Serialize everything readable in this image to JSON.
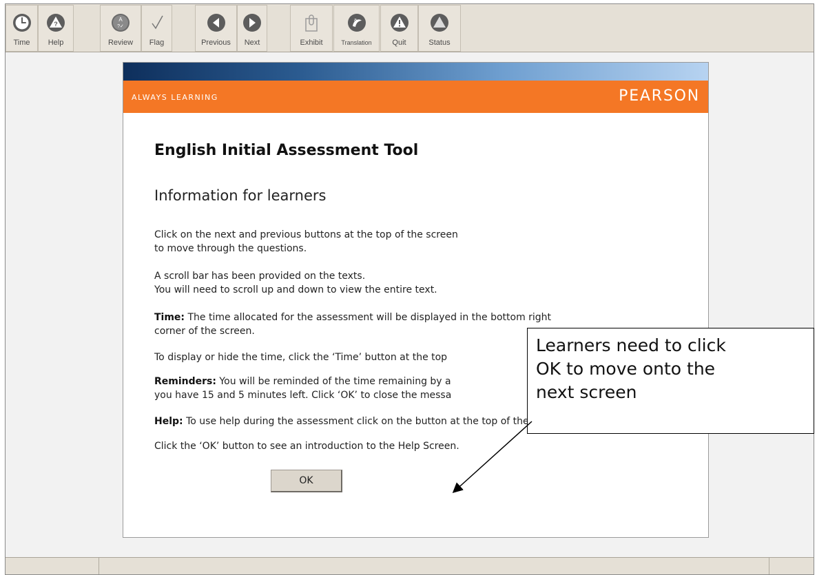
{
  "toolbar": {
    "buttons": [
      {
        "label": "Time",
        "icon": "clock-icon"
      },
      {
        "label": "Help",
        "icon": "help-icon"
      },
      {
        "label": "Review",
        "icon": "review-icon"
      },
      {
        "label": "Flag",
        "icon": "flag-checkmark-icon"
      },
      {
        "label": "Previous",
        "icon": "previous-icon"
      },
      {
        "label": "Next",
        "icon": "next-icon"
      },
      {
        "label": "Exhibit",
        "icon": "exhibit-icon"
      },
      {
        "label": "Translation",
        "icon": "translation-icon"
      },
      {
        "label": "Quit",
        "icon": "quit-icon"
      },
      {
        "label": "Status",
        "icon": "status-icon"
      }
    ]
  },
  "banner": {
    "tagline": "ALWAYS LEARNING",
    "brand": "PEARSON",
    "accent_color": "#f47725"
  },
  "dialog": {
    "title": "English Initial Assessment Tool",
    "subtitle": "Information for learners",
    "p1_line1": "Click on the next and previous buttons at the top of the screen",
    "p1_line2": "to move through the questions.",
    "p2_line1": "A scroll bar has been provided on the texts.",
    "p2_line2": "You will need to scroll up and down to view the entire text.",
    "p3_label": "Time:",
    "p3_line1": " The time allocated for the assessment will be displayed in the bottom right",
    "p3_line2": "corner of the screen.",
    "p4_line1": "To display or hide the time, click the ‘Time’ button at the top",
    "p5_label": "Reminders:",
    "p5_line1": " You will be reminded of the time remaining by a",
    "p5_line2": "you have 15 and 5 minutes left. Click ‘OK’ to close the messa",
    "p6_label": "Help:",
    "p6_line1": " To use help during the assessment click on the button at the top of the screen.",
    "p7_line1": "Click the ‘OK’  button to see an introduction to the Help Screen.",
    "ok_label": "OK"
  },
  "callout": {
    "line1": "Learners need to click",
    "line2": "OK to move onto the",
    "line3": "next screen"
  }
}
